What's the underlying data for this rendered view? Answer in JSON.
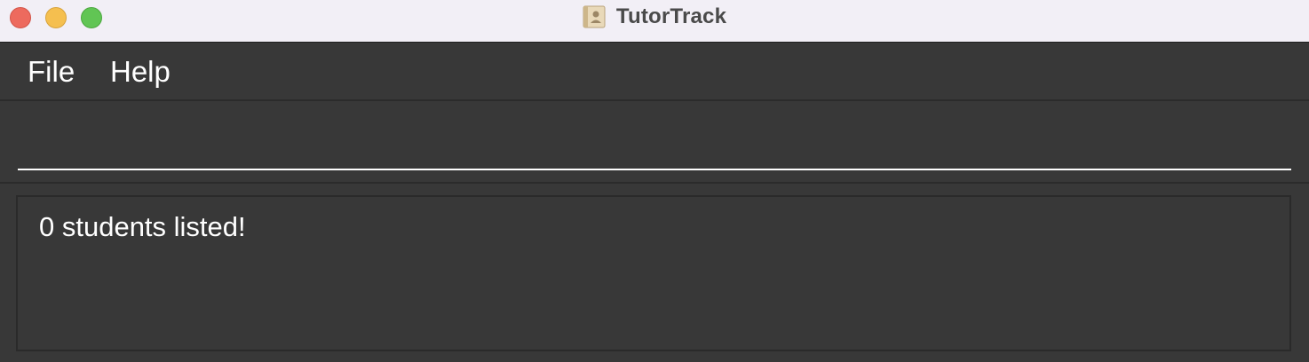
{
  "window": {
    "title": "TutorTrack",
    "app_icon": "address-book-icon",
    "controls": {
      "close": "#ed6a5e",
      "minimize": "#f5bf4f",
      "maximize": "#61c554"
    }
  },
  "menu": {
    "items": [
      {
        "label": "File"
      },
      {
        "label": "Help"
      }
    ]
  },
  "command_box": {
    "value": "",
    "placeholder": ""
  },
  "result_display": {
    "message": "0 students listed!"
  },
  "colors": {
    "background": "#383838",
    "titlebar": "#f2eff6",
    "text": "#ffffff",
    "border": "#2b2b2b"
  }
}
